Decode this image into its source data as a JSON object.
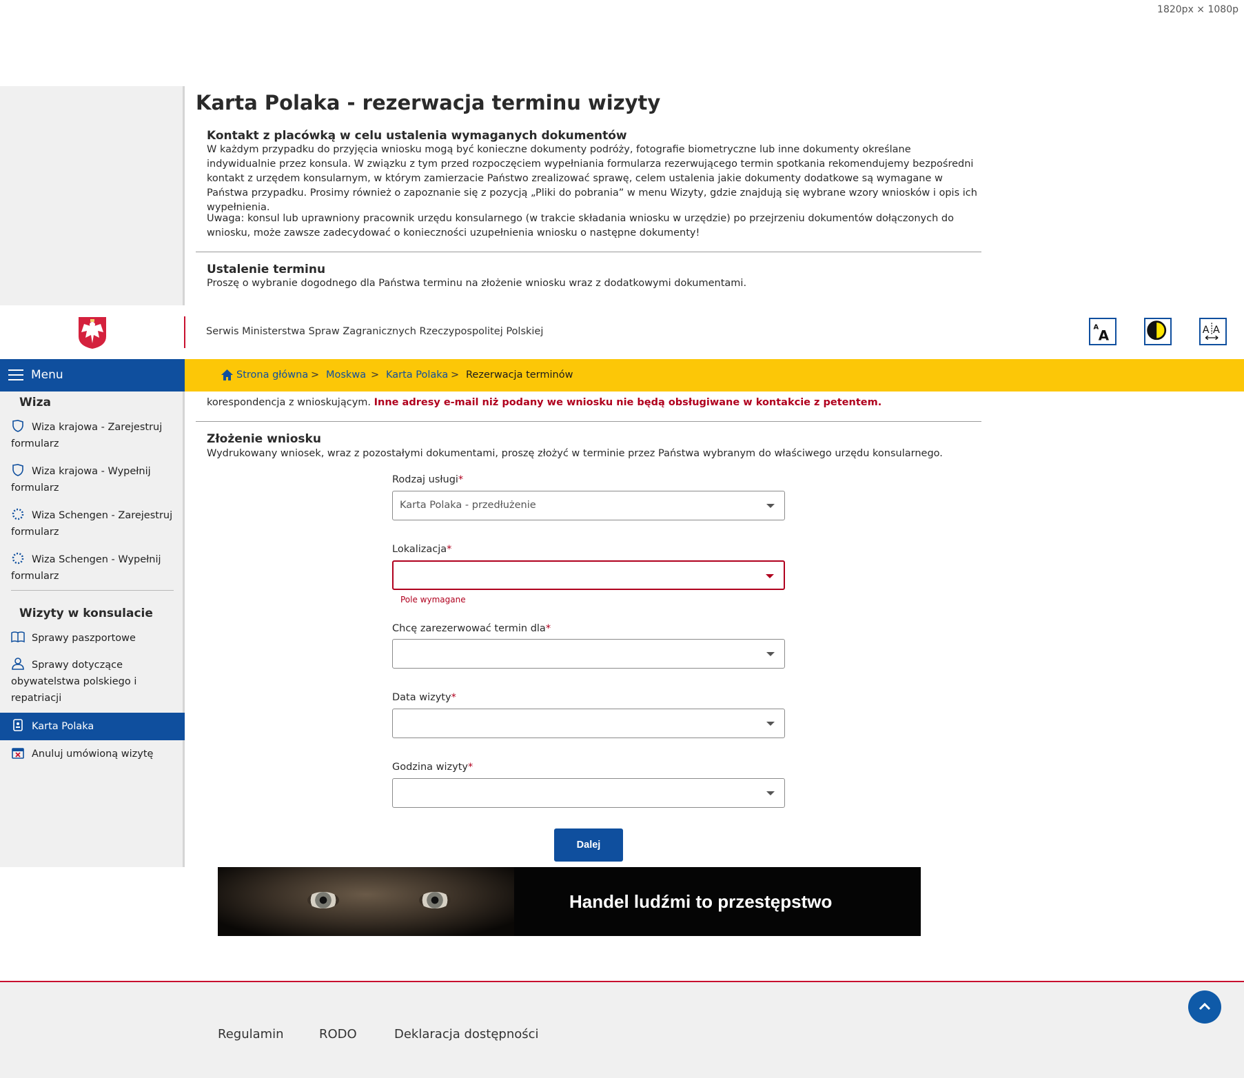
{
  "viewport_note": "1820px × 1080p",
  "page": {
    "title": "Karta Polaka - rezerwacja terminu wizyty"
  },
  "header": {
    "service_name": "Serwis Ministerstwa Spraw Zagranicznych Rzeczypospolitej Polskiej",
    "tools": [
      "font-size-icon",
      "contrast-icon",
      "letter-spacing-icon"
    ]
  },
  "menu": {
    "label": "Menu",
    "sections": [
      {
        "heading": "Wiza",
        "items": [
          {
            "label": "Wiza krajowa -  Zarejestruj formularz",
            "icon": "shield-icon"
          },
          {
            "label": "Wiza krajowa -  Wypełnij formularz",
            "icon": "shield-icon"
          },
          {
            "label": "Wiza Schengen -  Zarejestruj formularz",
            "icon": "eu-stars-icon"
          },
          {
            "label": "Wiza Schengen -  Wypełnij formularz",
            "icon": "eu-stars-icon"
          }
        ]
      },
      {
        "heading": "Wizyty w konsulacie",
        "items": [
          {
            "label": "Sprawy paszportowe",
            "icon": "passport-book-icon"
          },
          {
            "label": "Sprawy dotyczące obywatelstwa polskiego i repatriacji",
            "icon": "person-icon"
          },
          {
            "label": "Karta Polaka",
            "icon": "id-card-icon",
            "active": true
          },
          {
            "label": "Anuluj umówioną wizytę",
            "icon": "calendar-cancel-icon"
          }
        ]
      }
    ]
  },
  "breadcrumb": [
    "Strona główna",
    "Moskwa",
    "Karta Polaka",
    "Rezerwacja terminów"
  ],
  "breadcrumb_separator": ">",
  "sections": {
    "contact": {
      "title": "Kontakt z placówką w celu ustalenia wymaganych dokumentów",
      "text1": "W każdym przypadku do przyjęcia wniosku mogą być konieczne dokumenty podróży, fotografie biometryczne lub inne dokumenty określane indywidualnie przez konsula. W związku z tym przed rozpoczęciem wypełniania formularza rezerwującego termin spotkania rekomendujemy bezpośredni kontakt z urzędem konsularnym, w którym zamierzacie Państwo zrealizować sprawę, celem ustalenia jakie dokumenty dodatkowe są wymagane w Państwa przypadku. Prosimy również o zapoznanie się z pozycją „Pliki do pobrania” w menu Wizyty, gdzie znajdują się wybrane wzory wniosków i opis ich wypełnienia.",
      "text2": "Uwaga: konsul lub uprawniony pracownik urzędu konsularnego (w trakcie składania wniosku w urzędzie) po przejrzeniu dokumentów dołączonych do wniosku, może zawsze zadecydować o konieczności uzupełnienia wniosku o następne dokumenty!"
    },
    "date": {
      "title": "Ustalenie terminu",
      "text": "Proszę o wybranie dogodnego dla Państwa terminu na złożenie wniosku wraz z dodatkowymi dokumentami."
    },
    "email": {
      "text_plain": "korespondencja z wnioskującym.",
      "text_warning": "Inne adresy e-mail niż podany we wniosku nie będą obsługiwane w kontakcie z petentem."
    },
    "submit": {
      "title": "Złożenie wniosku",
      "text": "Wydrukowany wniosek, wraz z pozostałymi dokumentami, proszę złożyć w terminie przez Państwa wybranym do właściwego urzędu konsularnego."
    }
  },
  "form": {
    "required_mark": "*",
    "fields": [
      {
        "label": "Rodzaj usługi",
        "value": "Karta Polaka - przedłużenie",
        "error": ""
      },
      {
        "label": "Lokalizacja",
        "value": "",
        "error": "Pole wymagane"
      },
      {
        "label": "Chcę zarezerwować termin dla",
        "value": "",
        "error": ""
      },
      {
        "label": "Data wizyty",
        "value": "",
        "error": ""
      },
      {
        "label": "Godzina wizyty",
        "value": "",
        "error": ""
      }
    ],
    "next_label": "Dalej"
  },
  "banner": {
    "text": "Handel ludźmi to przestępstwo"
  },
  "footer": {
    "links": [
      "Regulamin",
      "RODO",
      "Deklaracja dostępności"
    ]
  },
  "colors": {
    "primary": "#0f4f9e",
    "breadcrumb_bar": "#fcc707",
    "error": "#b0001e",
    "accent_red": "#c8102e",
    "sidebar_bg": "#f0f0f0"
  }
}
